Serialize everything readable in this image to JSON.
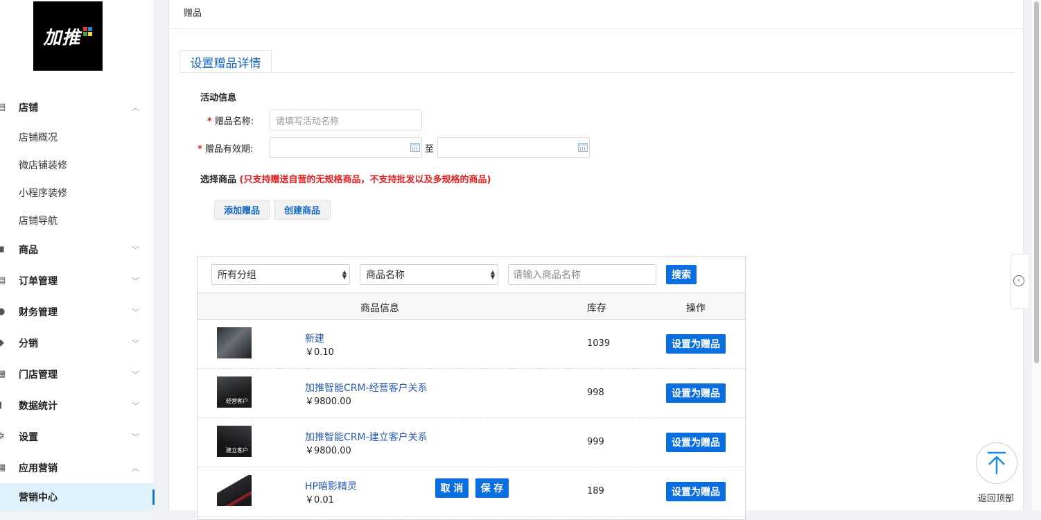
{
  "logo": {
    "text": "加推"
  },
  "sidebar": {
    "groups": [
      {
        "label": "店铺",
        "chevron": "︿",
        "icon": "store-icon"
      },
      {
        "label": "商品",
        "chevron": "﹀",
        "icon": "bag-icon"
      },
      {
        "label": "订单管理",
        "chevron": "﹀",
        "icon": "list-icon"
      },
      {
        "label": "财务管理",
        "chevron": "﹀",
        "icon": "coin-icon"
      },
      {
        "label": "分销",
        "chevron": "﹀",
        "icon": "location-icon"
      },
      {
        "label": "门店管理",
        "chevron": "﹀",
        "icon": "shop-icon"
      },
      {
        "label": "数据统计",
        "chevron": "﹀",
        "icon": "bar-chart-icon"
      },
      {
        "label": "设置",
        "chevron": "﹀",
        "icon": "gear-icon"
      },
      {
        "label": "应用营销",
        "chevron": "︿",
        "icon": "apps-icon"
      }
    ],
    "store_items": [
      "店铺概况",
      "微店铺装修",
      "小程序装修",
      "店铺导航"
    ],
    "active_item": "营销中心"
  },
  "breadcrumb": "赠品",
  "tab": {
    "label": "设置赠品详情"
  },
  "form": {
    "section_title": "活动信息",
    "name_label": "赠品名称:",
    "name_placeholder": "请填写活动名称",
    "validity_label": "赠品有效期:",
    "to_label": "至",
    "choose_label": "选择商品",
    "choose_warning": "(只支持赠送自营的无规格商品，不支持批发以及多规格的商品)",
    "add_gift_button": "添加赠品",
    "create_product_button": "创建商品"
  },
  "filter": {
    "group_select": "所有分组",
    "field_select": "商品名称",
    "search_placeholder": "请输入商品名称",
    "search_button": "搜索"
  },
  "table": {
    "headers": [
      "商品信息",
      "库存",
      "操作"
    ],
    "rows": [
      {
        "name": "新建",
        "price": "￥0.10",
        "stock": "1039",
        "action": "设置为赠品",
        "thumb_caption": ""
      },
      {
        "name": "加推智能CRM-经营客户关系",
        "price": "￥9800.00",
        "stock": "998",
        "action": "设置为赠品",
        "thumb_caption": "经营客户"
      },
      {
        "name": "加推智能CRM-建立客户关系",
        "price": "￥9800.00",
        "stock": "999",
        "action": "设置为赠品",
        "thumb_caption": "建立客户"
      },
      {
        "name": "HP暗影精灵",
        "price": "￥0.01",
        "stock": "189",
        "action": "设置为赠品",
        "thumb_caption": ""
      }
    ]
  },
  "floating": {
    "cancel_button": "取 消",
    "save_button": "保 存",
    "back_to_top": "返回顶部"
  },
  "colors": {
    "primary": "#0a6de0",
    "link": "#2a5db0",
    "warning": "#e02020",
    "active_bg": "#dff2fc"
  }
}
